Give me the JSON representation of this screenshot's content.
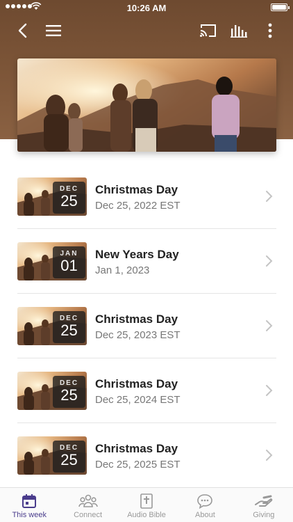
{
  "status_bar": {
    "time": "10:26 AM"
  },
  "colors": {
    "header": "#7b5437",
    "accent": "#4a3c8c"
  },
  "toolbar": {
    "icons": [
      "back-icon",
      "menu-icon",
      "cast-icon",
      "audio-levels-icon",
      "more-vertical-icon"
    ]
  },
  "events": [
    {
      "badge_month": "DEC",
      "badge_day": "25",
      "title": "Christmas Day",
      "subtitle": "Dec 25, 2022 EST"
    },
    {
      "badge_month": "JAN",
      "badge_day": "01",
      "title": "New Years Day",
      "subtitle": "Jan 1, 2023"
    },
    {
      "badge_month": "DEC",
      "badge_day": "25",
      "title": "Christmas Day",
      "subtitle": "Dec 25, 2023 EST"
    },
    {
      "badge_month": "DEC",
      "badge_day": "25",
      "title": "Christmas Day",
      "subtitle": "Dec 25, 2024 EST"
    },
    {
      "badge_month": "DEC",
      "badge_day": "25",
      "title": "Christmas Day",
      "subtitle": "Dec 25, 2025 EST"
    }
  ],
  "tabs": [
    {
      "label": "This week",
      "icon": "calendar-icon",
      "active": true
    },
    {
      "label": "Connect",
      "icon": "people-icon",
      "active": false
    },
    {
      "label": "Audio Bible",
      "icon": "bible-icon",
      "active": false
    },
    {
      "label": "About",
      "icon": "chat-bubble-icon",
      "active": false
    },
    {
      "label": "Giving",
      "icon": "giving-hand-icon",
      "active": false
    }
  ]
}
